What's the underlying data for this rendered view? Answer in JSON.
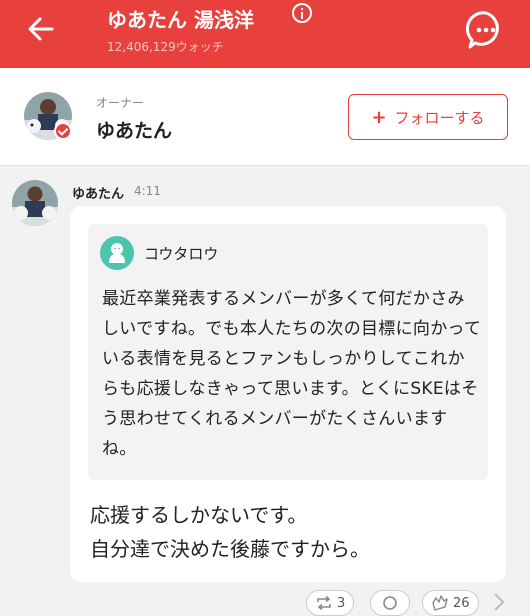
{
  "header": {
    "title": "ゆあたん 湯浅洋",
    "watch_count": "12,406,129ウォッチ",
    "back_icon": "arrow-left-icon",
    "info_icon": "info-icon",
    "chat_icon": "chat-bubble-icon"
  },
  "owner": {
    "role": "オーナー",
    "name": "ゆあたん",
    "follow_plus": "+",
    "follow_label": "フォローする"
  },
  "message": {
    "author": "ゆあたん",
    "time": "4:11",
    "quote": {
      "author": "コウタロウ",
      "text": "最近卒業発表するメンバーが多くて何だかさみしいですね。でも本人たちの次の目標に向かっている表情を見るとファンもしっかりしてこれからも応援しなきゃって思います。とくにSKEはそう思わせてくれるメンバーがたくさんいますね。"
    },
    "reply_lines": [
      "応援するしかないです。",
      "自分達で決めた後藤ですから。"
    ]
  },
  "actions": {
    "repost_count": "3",
    "like_count": "26"
  },
  "colors": {
    "accent": "#e8413d",
    "teal": "#4bc4b0"
  }
}
